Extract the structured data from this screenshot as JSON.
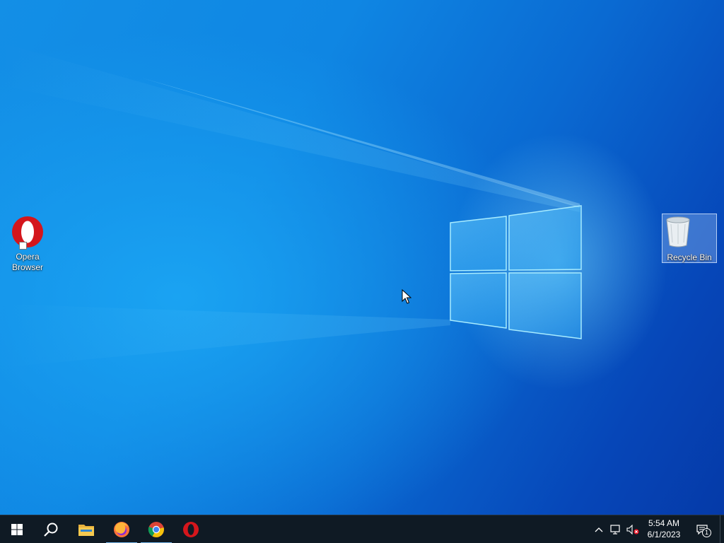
{
  "desktop": {
    "icons": [
      {
        "label": "Opera\nBrowser",
        "icon": "opera-icon"
      },
      {
        "label": "Recycle Bin",
        "icon": "recycle-bin-icon"
      }
    ]
  },
  "taskbar": {
    "start_icon": "windows-start-icon",
    "search_icon": "search-icon",
    "pinned": [
      {
        "name": "File Explorer",
        "icon": "folder-icon",
        "active": false
      },
      {
        "name": "Firefox",
        "icon": "firefox-icon",
        "active": true
      },
      {
        "name": "Google Chrome",
        "icon": "chrome-icon",
        "active": true
      },
      {
        "name": "Opera",
        "icon": "opera-icon",
        "active": false
      }
    ],
    "tray": {
      "icons": [
        "chevron-up-icon",
        "network-icon",
        "volume-muted-icon"
      ],
      "time": "5:54 AM",
      "date": "6/1/2023",
      "notification_count": "1"
    }
  },
  "colors": {
    "wallpaper_primary": "#0f86e3",
    "taskbar_bg": "#0f1a24",
    "active_indicator": "#76b9ed",
    "opera_red": "#d4161c"
  }
}
